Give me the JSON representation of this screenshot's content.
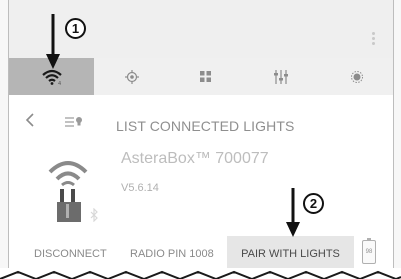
{
  "tabs": [
    {
      "icon": "wifi-icon",
      "active": true
    },
    {
      "icon": "target-icon",
      "active": false
    },
    {
      "icon": "grid-icon",
      "active": false
    },
    {
      "icon": "sliders-icon",
      "active": false
    },
    {
      "icon": "sun-icon",
      "active": false
    }
  ],
  "header": {
    "title": "LIST CONNECTED LIGHTS"
  },
  "device": {
    "name": "AsteraBox™ 700077",
    "version": "V5.6.14"
  },
  "actions": {
    "disconnect_label": "DISCONNECT",
    "radio_pin_label": "RADIO PIN 1008",
    "pair_label": "PAIR WITH LIGHTS"
  },
  "battery": {
    "level": "98"
  },
  "annotations": {
    "step1": "1",
    "step2": "2"
  },
  "colors": {
    "active_tab": "#b5b5b5",
    "primary_button": "#e6e6e6",
    "annotation": "#111111"
  }
}
